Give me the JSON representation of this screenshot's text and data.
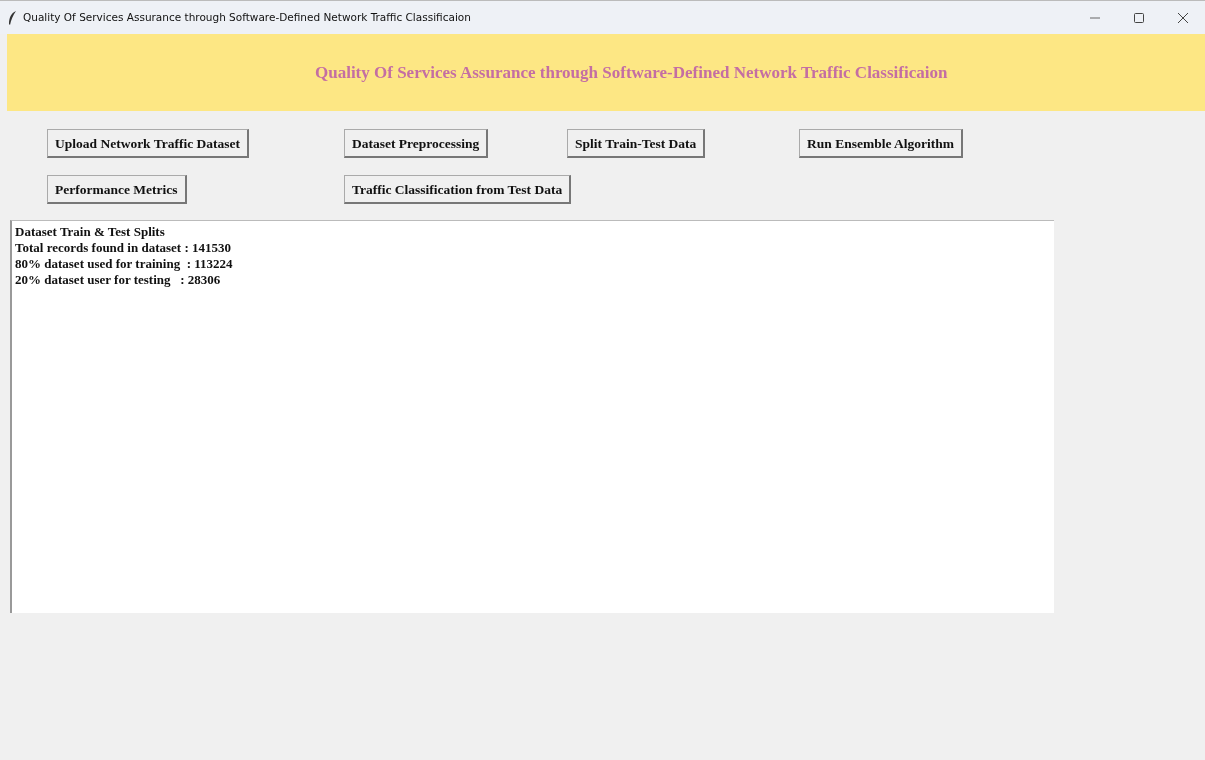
{
  "window": {
    "title": "Quality Of Services Assurance through Software-Defined Network Traffic Classificaion"
  },
  "header": {
    "title": "Quality Of Services Assurance through Software-Defined Network Traffic Classificaion"
  },
  "button_rows": [
    [
      "Upload Network Traffic Dataset",
      "Dataset Preprocessing",
      "Split Train-Test Data",
      "Run Ensemble Algorithm"
    ],
    [
      "Performance Metrics",
      "Traffic Classification from Test Data"
    ]
  ],
  "output": {
    "lines": [
      "Dataset Train & Test Splits",
      "Total records found in dataset : 141530",
      "80% dataset used for training  : 113224",
      "20% dataset user for testing   : 28306"
    ]
  }
}
